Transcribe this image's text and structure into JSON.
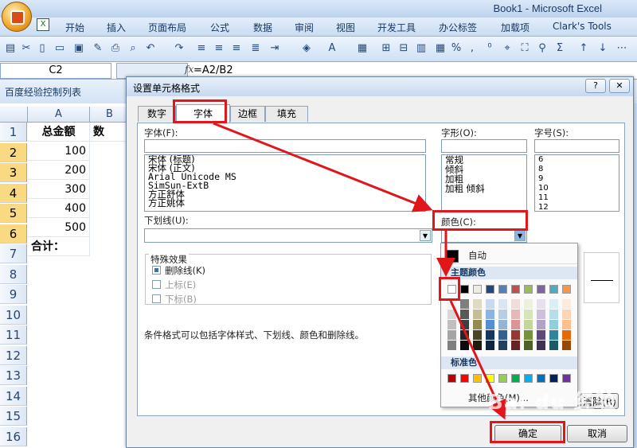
{
  "window": {
    "title": "Book1 - Microsoft Excel"
  },
  "menu": [
    "开始",
    "插入",
    "页面布局",
    "公式",
    "数据",
    "审阅",
    "视图",
    "开发工具",
    "办公标签",
    "加载项",
    "Clark's Tools"
  ],
  "formula_bar": {
    "cell_ref": "C2",
    "fx": "fx",
    "formula": "=A2/B2"
  },
  "panel_tab": "百度经验控制列表",
  "sheet": {
    "columns": [
      "A",
      "B"
    ],
    "rows": [
      "1",
      "2",
      "3",
      "4",
      "5",
      "6",
      "7",
      "8",
      "9",
      "10",
      "11",
      "12",
      "13",
      "14",
      "15",
      "16"
    ],
    "cells": [
      "总金额",
      "100",
      "200",
      "300",
      "400",
      "500",
      "合计："
    ],
    "b1_partial": "数"
  },
  "dialog": {
    "title": "设置单元格格式",
    "help": "?",
    "close": "✕",
    "tabs": [
      "数字",
      "字体",
      "边框",
      "填充"
    ],
    "font_label": "字体(F):",
    "fonts": [
      "宋体 (标题)",
      "宋体 (正文)",
      "Arial Unicode MS",
      "SimSun-ExtB",
      "方正舒体",
      "方正姚体"
    ],
    "style_label": "字形(O):",
    "styles": [
      "常规",
      "倾斜",
      "加粗",
      "加粗 倾斜"
    ],
    "size_label": "字号(S):",
    "sizes": [
      "6",
      "8",
      "9",
      "10",
      "11",
      "12"
    ],
    "underline_label": "下划线(U):",
    "color_label": "颜色(C):",
    "effects_label": "特殊效果",
    "strike": "删除线(K)",
    "super": "上标(E)",
    "sub": "下标(B)",
    "note": "条件格式可以包括字体样式、下划线、颜色和删除线。",
    "clear_btn": "清除(R)",
    "ok": "确定",
    "cancel": "取消"
  },
  "color_popup": {
    "auto": "自动",
    "theme_title": "主题颜色",
    "standard_title": "标准色",
    "more": "其他颜色(M)...",
    "theme_top": [
      "#ffffff",
      "#000000",
      "#eeece1",
      "#1f497d",
      "#4f81bd",
      "#c0504d",
      "#9bbb59",
      "#8064a2",
      "#4bacc6",
      "#f79646"
    ],
    "theme_shades": [
      [
        "#f2f2f2",
        "#7f7f7f",
        "#ddd9c3",
        "#c6d9f0",
        "#dbe5f1",
        "#f2dcdb",
        "#ebf1dd",
        "#e5e0ec",
        "#dbeef3",
        "#fdeada"
      ],
      [
        "#d8d8d8",
        "#595959",
        "#c4bd97",
        "#8db3e2",
        "#b8cce4",
        "#e5b9b7",
        "#d7e3bc",
        "#ccc1d9",
        "#b7dde8",
        "#fbd5b5"
      ],
      [
        "#bfbfbf",
        "#3f3f3f",
        "#938953",
        "#548dd4",
        "#95b3d7",
        "#d99694",
        "#c3d69b",
        "#b2a2c7",
        "#92cddc",
        "#fac08f"
      ],
      [
        "#a5a5a5",
        "#262626",
        "#494429",
        "#17365d",
        "#366092",
        "#953734",
        "#76923c",
        "#5f497a",
        "#31859b",
        "#e36c09"
      ],
      [
        "#7f7f7f",
        "#0c0c0c",
        "#1d1b10",
        "#0f243e",
        "#244061",
        "#632423",
        "#4f6128",
        "#3f3151",
        "#205867",
        "#974806"
      ]
    ],
    "standard": [
      "#c00000",
      "#ff0000",
      "#ffc000",
      "#ffff00",
      "#92d050",
      "#00b050",
      "#00b0f0",
      "#0070c0",
      "#002060",
      "#7030a0"
    ]
  },
  "watermark": "Bai du 经验"
}
